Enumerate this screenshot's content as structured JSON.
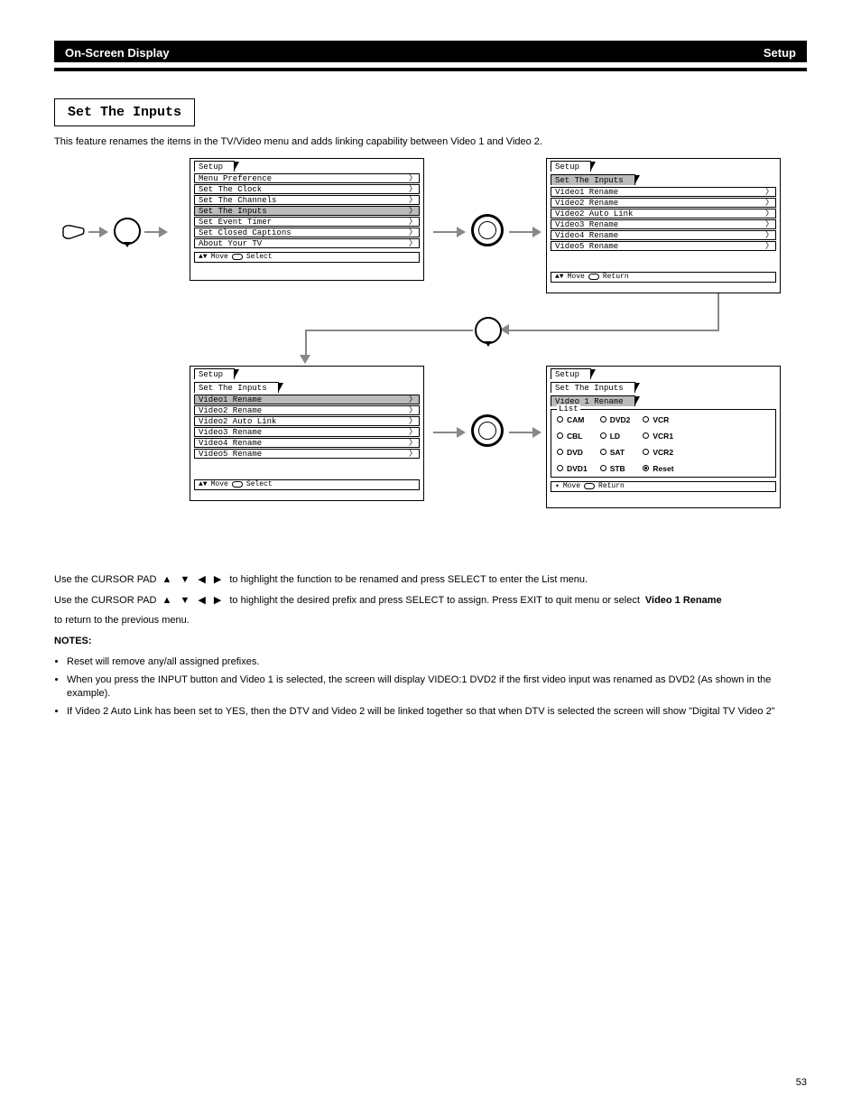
{
  "header": {
    "left": "On-Screen Display",
    "right": "Setup"
  },
  "section_title": "Set The Inputs",
  "intro": "This feature renames the items in the TV/Video menu and adds linking capability between Video 1 and Video 2.",
  "menus": {
    "setup": {
      "tab": "Setup",
      "items": [
        "Menu Preference",
        "Set The Clock",
        "Set The Channels",
        "Set The Inputs",
        "Set Event Timer",
        "Set Closed Captions",
        "About Your TV"
      ],
      "selected": "Set The Inputs",
      "footer_move": "Move",
      "footer_action": "Select"
    },
    "inputs1": {
      "tab": "Setup",
      "subtab": "Set The Inputs",
      "items": [
        "Video1 Rename",
        "Video2 Rename",
        "Video2 Auto Link",
        "Video3 Rename",
        "Video4 Rename",
        "Video5 Rename"
      ],
      "footer_move": "Move",
      "footer_action": "Return"
    },
    "inputs2": {
      "tab": "Setup",
      "subtab": "Set The Inputs",
      "items": [
        "Video1 Rename",
        "Video2 Rename",
        "Video2 Auto Link",
        "Video3 Rename",
        "Video4 Rename",
        "Video5 Rename"
      ],
      "selected": "Video1 Rename",
      "footer_move": "Move",
      "footer_action": "Select"
    },
    "rename": {
      "tab": "Setup",
      "subtab": "Set The Inputs",
      "subtab2": "Video 1 Rename",
      "list_label": "List",
      "cols": [
        [
          "CAM",
          "CBL",
          "DVD",
          "DVD1"
        ],
        [
          "DVD2",
          "LD",
          "SAT",
          "STB"
        ],
        [
          "VCR",
          "VCR1",
          "VCR2",
          "Reset"
        ]
      ],
      "selected": "Reset",
      "footer_move": "Move",
      "footer_action": "Return"
    }
  },
  "body": {
    "line1": "Use the CURSOR PAD",
    "line1b": "to highlight the function to be renamed and press SELECT to enter the List menu.",
    "line2a": "Use the CURSOR PAD",
    "line2b": "to highlight the desired prefix and press SELECT to assign. Press EXIT to quit menu or select",
    "bold": "Video 1 Rename",
    "line2c": "to return to the previous menu.",
    "notes_title": "NOTES:",
    "notes": [
      "Reset will remove any/all assigned prefixes.",
      "When you press the INPUT button and Video 1 is selected, the screen will display VIDEO:1 DVD2 if the first video input was renamed as DVD2 (As shown in the example).",
      "If Video 2 Auto Link has been set to YES, then the DTV and Video 2 will be linked together so that when DTV is selected the screen will show \"Digital TV Video 2\""
    ]
  },
  "page_number": "53"
}
